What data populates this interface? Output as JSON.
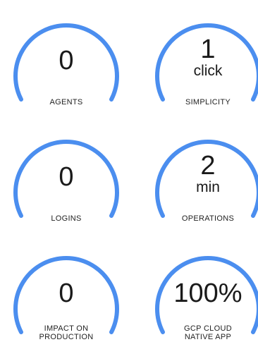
{
  "accent_color": "#4b8eef",
  "stats": [
    {
      "value": "0",
      "unit": "",
      "label_lines": [
        "AGENTS"
      ]
    },
    {
      "value": "1",
      "unit": "click",
      "label_lines": [
        "SIMPLICITY"
      ]
    },
    {
      "value": "0",
      "unit": "",
      "label_lines": [
        "LOGINS"
      ]
    },
    {
      "value": "2",
      "unit": "min",
      "label_lines": [
        "OPERATIONS"
      ]
    },
    {
      "value": "0",
      "unit": "",
      "label_lines": [
        "IMPACT ON",
        "PRODUCTION"
      ]
    },
    {
      "value": "100%",
      "unit": "",
      "label_lines": [
        "GCP CLOUD",
        "NATIVE APP"
      ]
    }
  ]
}
